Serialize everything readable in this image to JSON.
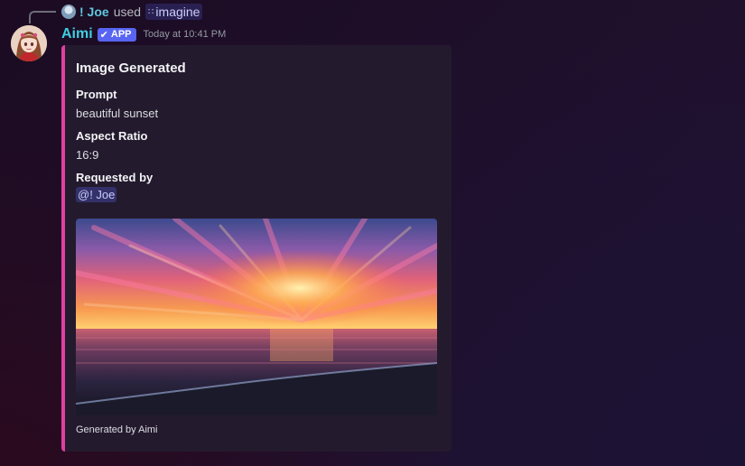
{
  "reply": {
    "user": "! Joe",
    "used_text": "used",
    "command": "imagine"
  },
  "message": {
    "bot_name": "Aimi",
    "badge": "APP",
    "timestamp": "Today at 10:41 PM"
  },
  "embed": {
    "accent_color": "#e040a0",
    "title": "Image Generated",
    "fields": [
      {
        "name": "Prompt",
        "value": "beautiful sunset"
      },
      {
        "name": "Aspect Ratio",
        "value": "16:9"
      },
      {
        "name": "Requested by",
        "value": "@! Joe"
      }
    ],
    "footer": "Generated by Aimi"
  },
  "colors": {
    "bot_name": "#3fcfe2",
    "reply_user": "#5ec8de",
    "badge_bg": "#5865f2",
    "embed_bg": "#241a2e"
  },
  "icons": {
    "command": "slash-command-icon",
    "badge_check": "checkmark-icon"
  }
}
